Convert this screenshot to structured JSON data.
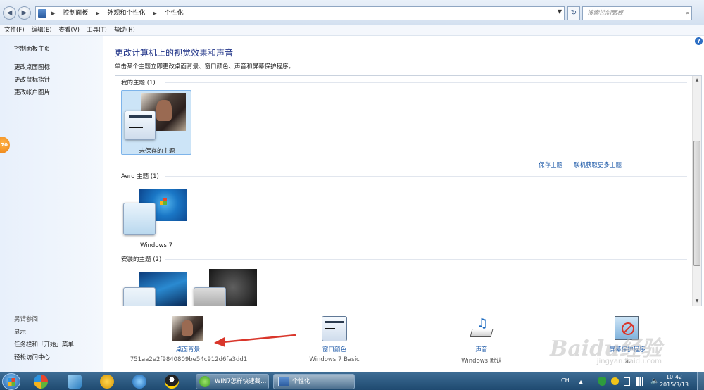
{
  "address": {
    "crumbs": [
      "控制面板",
      "外观和个性化",
      "个性化"
    ],
    "search_placeholder": "搜索控制面板"
  },
  "menu": [
    "文件(F)",
    "编辑(E)",
    "查看(V)",
    "工具(T)",
    "帮助(H)"
  ],
  "left": {
    "home": "控制面板主页",
    "links": [
      "更改桌面图标",
      "更改鼠标指针",
      "更改帐户图片"
    ],
    "see_also_title": "另请参阅",
    "see_also": [
      "显示",
      "任务栏和「开始」菜单",
      "轻松访问中心"
    ],
    "badge": "70"
  },
  "main": {
    "title": "更改计算机上的视觉效果和声音",
    "subtitle": "单击某个主题立即更改桌面背景、窗口颜色、声音和屏幕保护程序。",
    "my_themes": "我的主题 (1)",
    "unsaved_theme": "未保存的主题",
    "save_theme": "保存主题",
    "get_more": "联机获取更多主题",
    "aero_themes": "Aero 主题 (1)",
    "windows7": "Windows 7",
    "installed_themes": "安装的主题 (2)"
  },
  "bottom": {
    "background_label": "桌面背景",
    "background_value": "751aa2e2f9840809be54c912d6fa3dd1",
    "color_label": "窗口颜色",
    "color_value": "Windows 7 Basic",
    "sound_label": "声音",
    "sound_value": "Windows 默认",
    "saver_label": "屏幕保护程序",
    "saver_value": "无"
  },
  "taskbar": {
    "task1": "WIN7怎样快速截...",
    "task2": "个性化",
    "lang": "CH",
    "time": "10:42",
    "date": "2015/3/13"
  },
  "watermark": "Baidu经验",
  "watermark_url": "jingyan.baidu.com",
  "colors": {
    "accent": "#1e5aa8",
    "title": "#1e3287",
    "selected": "#cce4f7"
  }
}
